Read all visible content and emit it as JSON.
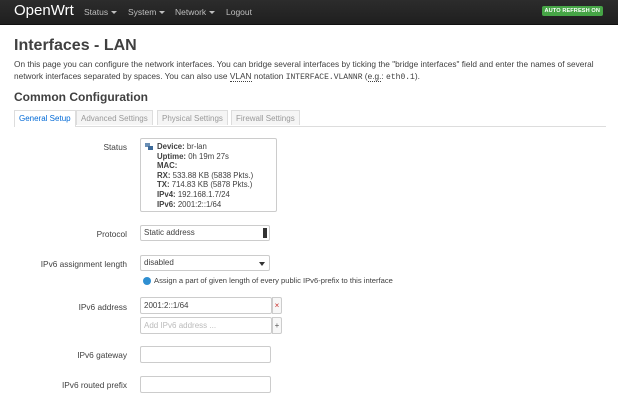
{
  "header": {
    "brand": "OpenWrt",
    "menu": [
      "Status",
      "System",
      "Network",
      "Logout"
    ],
    "auto_refresh": "AUTO REFRESH ON"
  },
  "page": {
    "title": "Interfaces - LAN",
    "description_1": "On this page you can configure the network interfaces. You can bridge several interfaces by ticking the \"bridge interfaces\" field and enter the names of several network interfaces separated by spaces. You can also use ",
    "vlan_abbr": "VLAN",
    "description_2": " notation ",
    "vlan_notation": "INTERFACE.VLANNR",
    "description_3": " (",
    "eg_abbr": "e.g.",
    "description_4": ": ",
    "eg_value": "eth0.1",
    "description_5": ").",
    "section_title": "Common Configuration"
  },
  "tabs": [
    "General Setup",
    "Advanced Settings",
    "Physical Settings",
    "Firewall Settings"
  ],
  "form": {
    "status_label": "Status",
    "status": {
      "device_label": "Device:",
      "device": "br-lan",
      "uptime_label": "Uptime:",
      "uptime": "0h 19m 27s",
      "mac_label": "MAC:",
      "mac": "",
      "rx_label": "RX:",
      "rx": "533.88 KB (5838 Pkts.)",
      "tx_label": "TX:",
      "tx": "714.83 KB (5878 Pkts.)",
      "ipv4_label": "IPv4:",
      "ipv4": "192.168.1.7/24",
      "ipv6_label": "IPv6:",
      "ipv6": "2001:2::1/64"
    },
    "protocol_label": "Protocol",
    "protocol_value": "Static address",
    "ipv6_assign_label": "IPv6 assignment length",
    "ipv6_assign_value": "disabled",
    "ipv6_assign_hint": "Assign a part of given length of every public IPv6-prefix to this interface",
    "ipv6_address_label": "IPv6 address",
    "ipv6_address_value": "2001:2::1/64",
    "ipv6_address_placeholder": "Add IPv6 address ...",
    "ipv6_gateway_label": "IPv6 gateway",
    "ipv6_routed_label": "IPv6 routed prefix",
    "remove_symbol": "×",
    "add_symbol": "+"
  },
  "colors": {
    "accent": "#0069d6",
    "auto_refresh_bg": "#46a546",
    "topbar": "#222222"
  }
}
